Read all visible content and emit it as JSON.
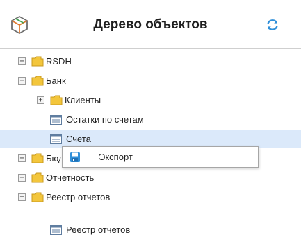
{
  "header": {
    "title": "Дерево объектов",
    "logo_icon": "cube-outline-icon",
    "refresh_icon": "refresh-icon"
  },
  "tree": {
    "items": [
      {
        "label": "RSDH",
        "type": "folder",
        "expandable": true,
        "expanded": false,
        "level": 0
      },
      {
        "label": "Банк",
        "type": "folder",
        "expandable": true,
        "expanded": true,
        "level": 0
      },
      {
        "label": "Клиенты",
        "type": "folder",
        "expandable": true,
        "expanded": false,
        "level": 1
      },
      {
        "label": "Остатки по счетам",
        "type": "report",
        "expandable": false,
        "level": 1
      },
      {
        "label": "Счета",
        "type": "report",
        "expandable": false,
        "level": 1,
        "selected": true
      },
      {
        "label": "Бюджет",
        "type": "folder",
        "expandable": true,
        "expanded": false,
        "level": 0
      },
      {
        "label": "Отчетность",
        "type": "folder",
        "expandable": true,
        "expanded": false,
        "level": 0
      },
      {
        "label": "Реестр отчетов",
        "type": "folder",
        "expandable": true,
        "expanded": true,
        "level": 0
      },
      {
        "label": "Реестр отчетов",
        "type": "report",
        "expandable": false,
        "level": 1
      }
    ]
  },
  "context_menu": {
    "items": [
      {
        "label": "Экспорт",
        "icon": "save-icon"
      }
    ]
  },
  "colors": {
    "folder": "#f3c63c",
    "selection": "#dbe9fa",
    "accent": "#2f8fd9"
  }
}
